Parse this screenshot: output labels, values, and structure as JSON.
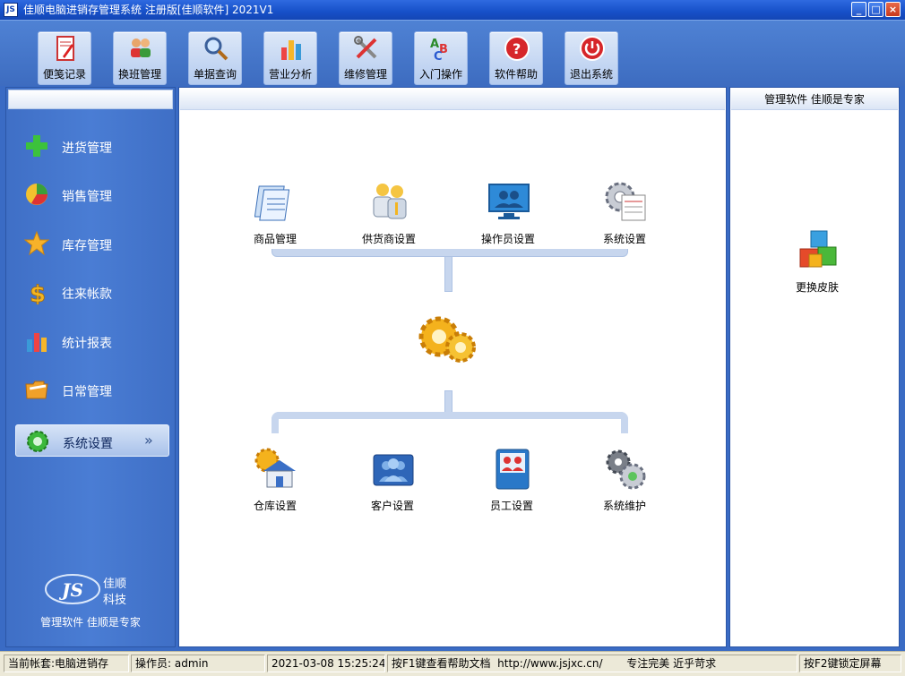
{
  "window": {
    "title": "佳顺电脑进销存管理系统 注册版[佳顺软件] 2021V1",
    "app_icon_text": "JS"
  },
  "toolbar": {
    "items": [
      {
        "label": "便笺记录",
        "icon": "notepad-icon"
      },
      {
        "label": "换班管理",
        "icon": "users-swap-icon"
      },
      {
        "label": "单据查询",
        "icon": "magnifier-icon"
      },
      {
        "label": "营业分析",
        "icon": "bar-chart-icon"
      },
      {
        "label": "维修管理",
        "icon": "tools-icon"
      },
      {
        "label": "入门操作",
        "icon": "abc-icon"
      },
      {
        "label": "软件帮助",
        "icon": "help-icon"
      },
      {
        "label": "退出系统",
        "icon": "power-icon"
      }
    ]
  },
  "sidebar": {
    "items": [
      {
        "label": "进货管理",
        "icon": "plus-icon"
      },
      {
        "label": "销售管理",
        "icon": "pie-chart-icon"
      },
      {
        "label": "库存管理",
        "icon": "star-icon"
      },
      {
        "label": "往来帐款",
        "icon": "dollar-icon"
      },
      {
        "label": "统计报表",
        "icon": "bar-chart-icon"
      },
      {
        "label": "日常管理",
        "icon": "folder-icon"
      },
      {
        "label": "系统设置",
        "icon": "gear-icon",
        "active": true
      }
    ],
    "active_chevron": "»",
    "logo_mark": "JS",
    "logo_name_line1": "佳顺",
    "logo_name_line2": "科技",
    "slogan": "管理软件 佳顺是专家"
  },
  "main": {
    "top_functions": [
      {
        "label": "商品管理",
        "icon": "documents-icon"
      },
      {
        "label": "供货商设置",
        "icon": "people-icon"
      },
      {
        "label": "操作员设置",
        "icon": "monitor-users-icon"
      },
      {
        "label": "系统设置",
        "icon": "settings-sheet-icon"
      }
    ],
    "hub_icon": "gears-icon",
    "bottom_functions": [
      {
        "label": "仓库设置",
        "icon": "warehouse-icon"
      },
      {
        "label": "客户设置",
        "icon": "customers-icon"
      },
      {
        "label": "员工设置",
        "icon": "staff-icon"
      },
      {
        "label": "系统维护",
        "icon": "maintenance-gears-icon"
      }
    ]
  },
  "right_panel": {
    "header": "管理软件  佳顺是专家",
    "skin_label": "更换皮肤",
    "skin_icon": "cubes-icon"
  },
  "statusbar": {
    "account": "当前帐套:电脑进销存",
    "operator": "操作员: admin",
    "datetime": "2021-03-08 15:25:24",
    "help": "按F1键查看帮助文档  http://www.jsjxc.cn/       专注完美 近乎苛求",
    "lock": "按F2键锁定屏幕"
  },
  "colors": {
    "titlebar": "#1650c8",
    "sidebar": "#4a7dd4",
    "toolbar": "#4f82d4",
    "panel_border": "#2c56a6"
  }
}
